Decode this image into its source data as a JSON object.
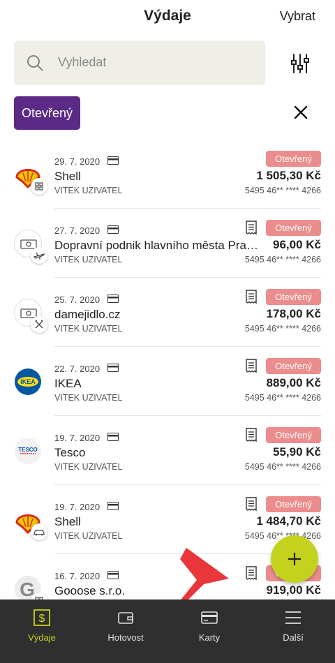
{
  "header": {
    "title": "Výdaje",
    "select_label": "Vybrat"
  },
  "search": {
    "placeholder": "Vyhledat"
  },
  "filter_chip": {
    "label": "Otevřený"
  },
  "transactions": [
    {
      "date": "29. 7. 2020",
      "merchant": "Shell",
      "user": "VITEK UZIVATEL",
      "status": "Otevřený",
      "amount": "1 505,30 Kč",
      "card": "5495 46** **** 4266",
      "logo": "shell",
      "badge": "grid-icon",
      "receipt": false
    },
    {
      "date": "27. 7. 2020",
      "merchant": "Dopravní podnik hlavního města Pra…",
      "user": "VITEK UZIVATEL",
      "status": "Otevřený",
      "amount": "96,00 Kč",
      "card": "5495 46** **** 4266",
      "logo": "cash",
      "badge": "plane-icon",
      "receipt": true
    },
    {
      "date": "25. 7. 2020",
      "merchant": "damejidlo.cz",
      "user": "VITEK UZIVATEL",
      "status": "Otevřený",
      "amount": "178,00 Kč",
      "card": "5495 46** **** 4266",
      "logo": "cash",
      "badge": "cutlery-icon",
      "receipt": true
    },
    {
      "date": "22. 7. 2020",
      "merchant": "IKEA",
      "user": "VITEK UZIVATEL",
      "status": "Otevřený",
      "amount": "889,00 Kč",
      "card": "5495 46** **** 4266",
      "logo": "ikea",
      "logo_text": "IKEA",
      "badge": "",
      "receipt": true
    },
    {
      "date": "19. 7. 2020",
      "merchant": "Tesco",
      "user": "VITEK UZIVATEL",
      "status": "Otevřený",
      "amount": "55,90 Kč",
      "card": "5495 46** **** 4266",
      "logo": "tesco",
      "logo_text": "TESCO",
      "badge": "",
      "receipt": true
    },
    {
      "date": "19. 7. 2020",
      "merchant": "Shell",
      "user": "VITEK UZIVATEL",
      "status": "Otevřený",
      "amount": "1 484,70 Kč",
      "card": "5495 46** **** 4266",
      "logo": "shell",
      "badge": "car-icon",
      "receipt": true
    },
    {
      "date": "16. 7. 2020",
      "merchant": "Gooose s.r.o.",
      "user": "",
      "status": "Otevřený",
      "amount": "919,00 Kč",
      "card": "",
      "logo": "gooose",
      "logo_text": "G",
      "badge": "grid-icon",
      "receipt": true
    }
  ],
  "fab": {
    "icon": "plus-icon"
  },
  "bottom_nav": [
    {
      "label": "Výdaje",
      "icon": "dollar-icon",
      "active": true
    },
    {
      "label": "Hotovost",
      "icon": "wallet-icon",
      "active": false
    },
    {
      "label": "Karty",
      "icon": "card-icon",
      "active": false
    },
    {
      "label": "Další",
      "icon": "menu-icon",
      "active": false
    }
  ],
  "colors": {
    "accent": "#5b2a86",
    "status": "#ec8d8d",
    "fab": "#c3d31d",
    "nav_bg": "#2f2f2f",
    "nav_active": "#c3d31d"
  }
}
